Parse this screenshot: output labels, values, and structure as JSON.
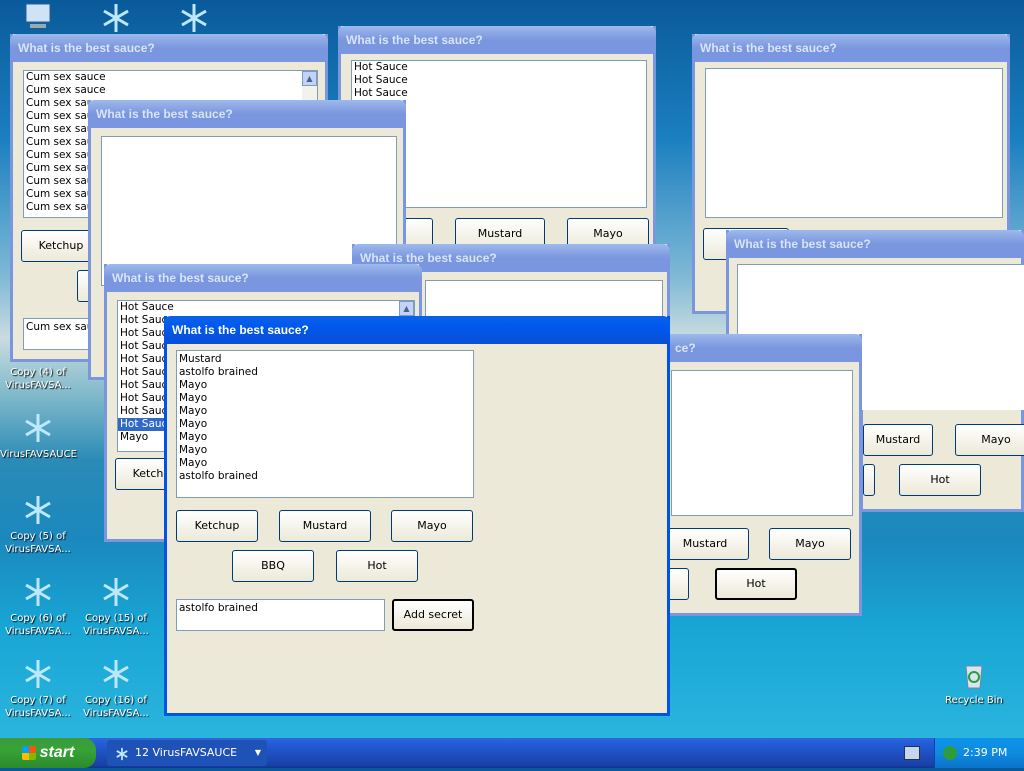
{
  "desktop_icons": [
    {
      "label": ""
    },
    {
      "label": ""
    },
    {
      "label": ""
    },
    {
      "label": "Copy (4) of VirusFAVSA..."
    },
    {
      "label": "VirusFAVSAUCE"
    },
    {
      "label": "Copy (5) of VirusFAVSA..."
    },
    {
      "label": "Copy (6) of VirusFAVSA..."
    },
    {
      "label": "Copy (15) of VirusFAVSA..."
    },
    {
      "label": "Copy (7) of VirusFAVSA..."
    },
    {
      "label": "Copy (16) of VirusFAVSA..."
    },
    {
      "label": "Recycle Bin"
    }
  ],
  "dialog_title": "What is the best sauce?",
  "dialog_title_partial": "ce?",
  "buttons": {
    "ketchup": "Ketchup",
    "mustard": "Mustard",
    "mayo": "Mayo",
    "bbq": "BBQ",
    "hot": "Hot",
    "add_secret": "Add secret"
  },
  "win_a": {
    "items": [
      "Cum sex sauce",
      "Cum sex sauce",
      "Cum sex sauce",
      "Cum sex sauce",
      "Cum sex sauce",
      "Cum sex sauce",
      "Cum sex sauce",
      "Cum sex sauce",
      "Cum sex sauce",
      "Cum sex sauce",
      "Cum sex sauce"
    ],
    "input": "Cum sex sauce"
  },
  "win_b": {
    "items": [
      "Hot Sauce",
      "Hot Sauce",
      "Hot Sauce"
    ]
  },
  "win_f": {
    "items": [
      "Hot Sauce",
      "Hot Sauce",
      "Hot Sauce",
      "Hot Sauce",
      "Hot Sauce",
      "Hot Sauce",
      "Hot Sauce",
      "Hot Sauce",
      "Hot Sauce",
      "Hot Sauce",
      "Mayo"
    ]
  },
  "win_main": {
    "items": [
      "Mustard",
      "astolfo brained",
      "Mayo",
      "Mayo",
      "Mayo",
      "Mayo",
      "Mayo",
      "Mayo",
      "Mayo",
      "astolfo brained"
    ],
    "input": "astolfo brained"
  },
  "taskbar": {
    "start": "start",
    "task": "12 VirusFAVSAUCE",
    "time": "2:39 PM"
  },
  "colors": {
    "titlebar_active": "#0058ee",
    "titlebar_inactive": "#7a96df",
    "dialog_bg": "#ece9d8",
    "selection": "#316ac5"
  }
}
